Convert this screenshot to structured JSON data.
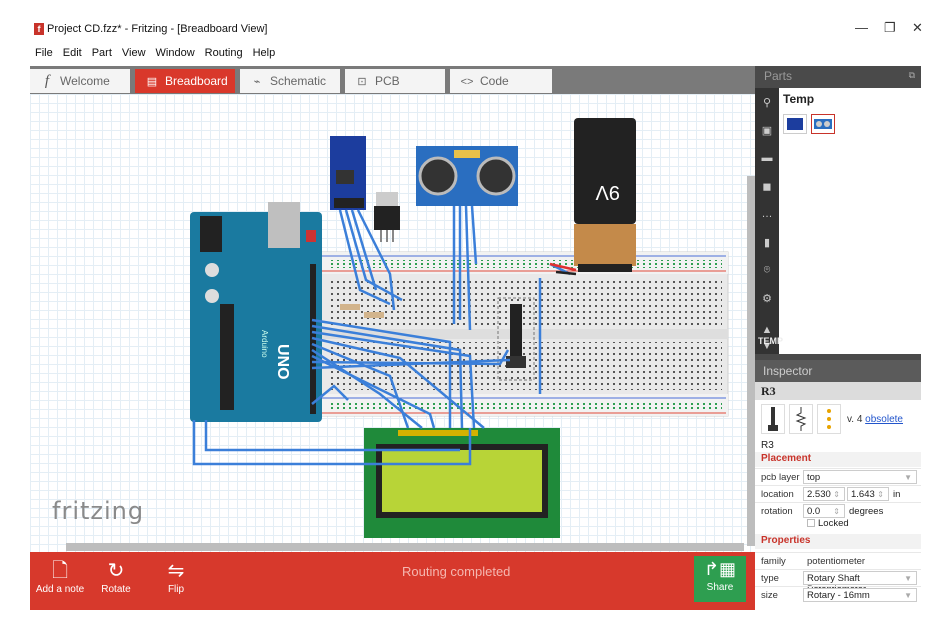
{
  "window": {
    "title": "Project CD.fzz* - Fritzing - [Breadboard View]",
    "icon": "fritzing-app-icon",
    "controls": [
      "—",
      "❐",
      "✕"
    ]
  },
  "menu": [
    "File",
    "Edit",
    "Part",
    "View",
    "Window",
    "Routing",
    "Help"
  ],
  "tabs": [
    {
      "label": "Welcome",
      "icon": "fritzing-f-icon",
      "active": false
    },
    {
      "label": "Breadboard",
      "icon": "breadboard-icon",
      "active": true
    },
    {
      "label": "Schematic",
      "icon": "schematic-icon",
      "active": false
    },
    {
      "label": "PCB",
      "icon": "pcb-icon",
      "active": false
    },
    {
      "label": "Code",
      "icon": "code-icon",
      "active": false
    }
  ],
  "canvas": {
    "logo": "fritzing",
    "battery_label": "9V",
    "arduino_label": "UNO",
    "arduino_brand": "Arduino"
  },
  "toolbar": {
    "add_note": "Add a note",
    "rotate": "Rotate",
    "flip": "Flip",
    "status": "Routing completed",
    "share": "Share"
  },
  "parts": {
    "title": "Parts",
    "search_bin": "Temp",
    "bin_label": "TEMP"
  },
  "inspector": {
    "title": "Inspector",
    "part_name": "R3",
    "version_text": "v. 4",
    "version_link": "obsolete",
    "part_caption": "R3",
    "placement_header": "Placement",
    "pcb_layer_label": "pcb layer",
    "pcb_layer_value": "top",
    "location_label": "location",
    "location_x": "2.530",
    "location_y": "1.643",
    "location_unit": "in",
    "rotation_label": "rotation",
    "rotation_value": "0.0",
    "rotation_unit": "degrees",
    "locked_label": "Locked",
    "properties_header": "Properties",
    "family_label": "family",
    "family_value": "potentiometer",
    "type_label": "type",
    "type_value": "Rotary Shaft Potentiometer",
    "size_label": "size",
    "size_value": "Rotary - 16mm"
  },
  "colors": {
    "accent": "#d9382b",
    "share": "#2e9e50",
    "wire": "#3b7fd9",
    "arduino": "#1a7aa0",
    "lcd_screen": "#b8d437",
    "lcd_board": "#1f8a3a"
  }
}
